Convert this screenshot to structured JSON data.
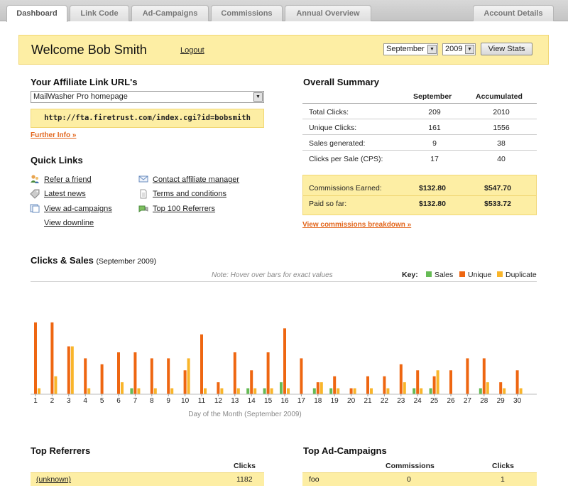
{
  "tabs": [
    {
      "label": "Dashboard",
      "active": true
    },
    {
      "label": "Link Code"
    },
    {
      "label": "Ad-Campaigns"
    },
    {
      "label": "Commissions"
    },
    {
      "label": "Annual Overview"
    },
    {
      "label": "Account Details"
    }
  ],
  "banner": {
    "welcome": "Welcome Bob Smith",
    "logout": "Logout",
    "month": "September",
    "year": "2009",
    "view_stats": "View Stats"
  },
  "affiliate": {
    "heading": "Your Affiliate Link URL's",
    "select_value": "MailWasher Pro homepage",
    "url": "http://fta.firetrust.com/index.cgi?id=bobsmith",
    "further_info": "Further Info »"
  },
  "quick_links": {
    "heading": "Quick Links",
    "left": [
      "Refer a friend",
      "Latest news",
      "View ad-campaigns",
      "View downline"
    ],
    "right": [
      "Contact affiliate manager",
      "Terms and conditions",
      "Top 100 Referrers"
    ]
  },
  "summary": {
    "heading": "Overall Summary",
    "col1": "September",
    "col2": "Accumulated",
    "rows": [
      {
        "label": "Total Clicks:",
        "month": "209",
        "total": "2010"
      },
      {
        "label": "Unique Clicks:",
        "month": "161",
        "total": "1556"
      },
      {
        "label": "Sales generated:",
        "month": "9",
        "total": "38"
      },
      {
        "label": "Clicks per Sale (CPS):",
        "month": "17",
        "total": "40"
      }
    ],
    "commissions": [
      {
        "label": "Commissions Earned:",
        "month": "$132.80",
        "total": "$547.70"
      },
      {
        "label": "Paid so far:",
        "month": "$132.80",
        "total": "$533.72"
      }
    ],
    "breakdown_link": "View commissions breakdown »"
  },
  "chart_title": "Clicks & Sales",
  "chart_sub": "(September 2009)",
  "chart_note": "Note: Hover over bars for exact values",
  "key_label": "Key:",
  "colors": {
    "sales": "#66bb55",
    "unique": "#ee6611",
    "duplicate": "#f9b52a"
  },
  "chart_data": {
    "type": "bar",
    "xlabel": "Day of the Month (September 2009)",
    "ylabel": "",
    "categories": [
      "1",
      "2",
      "3",
      "4",
      "5",
      "6",
      "7",
      "8",
      "9",
      "10",
      "11",
      "12",
      "13",
      "14",
      "15",
      "16",
      "17",
      "18",
      "19",
      "20",
      "21",
      "22",
      "23",
      "24",
      "25",
      "26",
      "27",
      "28",
      "29",
      "30"
    ],
    "series": [
      {
        "name": "Sales",
        "values": [
          0,
          0,
          0,
          0,
          0,
          0,
          1,
          0,
          0,
          0,
          0,
          0,
          0,
          1,
          1,
          2,
          0,
          1,
          1,
          0,
          0,
          0,
          0,
          1,
          1,
          0,
          0,
          1,
          0,
          0
        ]
      },
      {
        "name": "Unique",
        "values": [
          12,
          12,
          8,
          6,
          5,
          7,
          7,
          6,
          6,
          4,
          10,
          2,
          7,
          4,
          7,
          11,
          6,
          2,
          3,
          1,
          3,
          3,
          5,
          4,
          3,
          4,
          6,
          6,
          2,
          4
        ]
      },
      {
        "name": "Duplicate",
        "values": [
          1,
          3,
          8,
          1,
          0,
          2,
          1,
          1,
          1,
          6,
          1,
          1,
          1,
          1,
          1,
          1,
          0,
          2,
          1,
          1,
          1,
          1,
          2,
          1,
          4,
          0,
          0,
          2,
          1,
          1
        ]
      }
    ],
    "ylim": [
      0,
      14
    ],
    "legend": "top-right"
  },
  "top_referrers": {
    "heading": "Top Referrers",
    "col": "Clicks",
    "rows": [
      {
        "name": "(unknown)",
        "clicks": "1182"
      }
    ]
  },
  "top_campaigns": {
    "heading": "Top Ad-Campaigns",
    "col1": "Commissions",
    "col2": "Clicks",
    "rows": [
      {
        "name": "foo",
        "commissions": "0",
        "clicks": "1"
      }
    ]
  }
}
